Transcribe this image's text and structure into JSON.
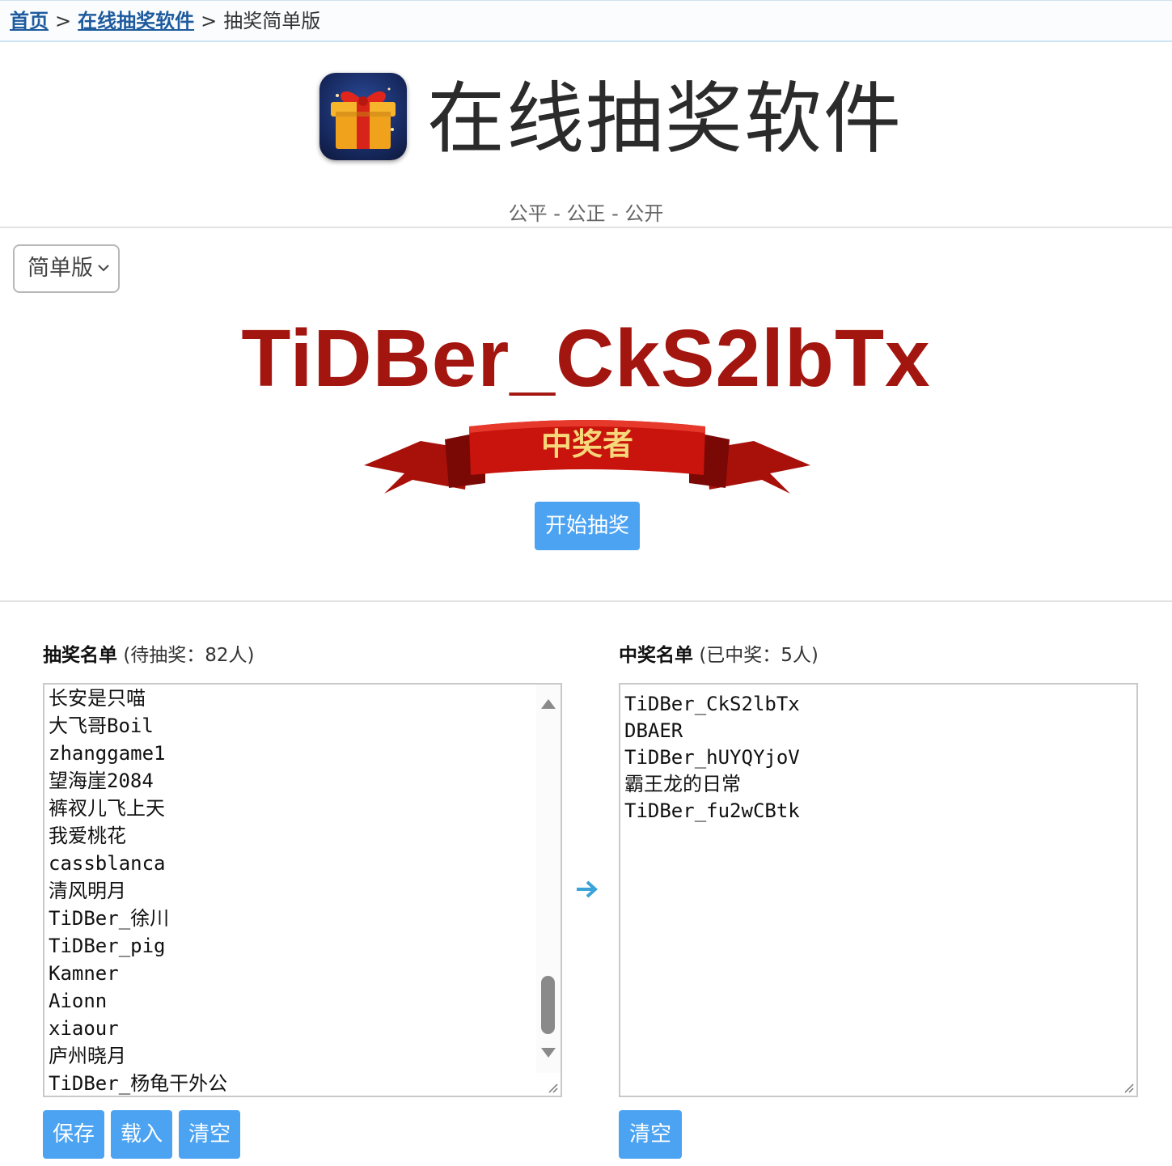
{
  "breadcrumb": {
    "home": "首页",
    "sep1": ">",
    "section": "在线抽奖软件",
    "sep2": ">",
    "current": "抽奖简单版"
  },
  "header": {
    "title": "在线抽奖软件",
    "subtitle": "公平 - 公正 - 公开"
  },
  "mode_select": {
    "value": "简单版"
  },
  "winner": {
    "name": "TiDBer_CkS2lbTx",
    "banner_text": "中奖者"
  },
  "start_button": "开始抽奖",
  "pool": {
    "title": "抽奖名单",
    "count_text": "(待抽奖：82人)",
    "entries": [
      "长安是只喵",
      "大飞哥Boil",
      "zhanggame1",
      "望海崖2084",
      "裤衩儿飞上天",
      "我爱桃花",
      "cassblanca",
      "清风明月",
      "TiDBer_徐川",
      "TiDBer_pig",
      "Kamner",
      "Aionn",
      "xiaour",
      "庐州晓月",
      "TiDBer_杨龟干外公"
    ],
    "buttons": {
      "save": "保存",
      "load": "载入",
      "clear": "清空"
    }
  },
  "winners": {
    "title": "中奖名单",
    "count_text": "(已中奖：5人)",
    "entries": [
      "TiDBer_CkS2lbTx",
      "DBAER",
      "TiDBer_hUYQYjoV",
      "霸王龙的日常",
      "TiDBer_fu2wCBtk"
    ],
    "buttons": {
      "clear": "清空"
    }
  },
  "colors": {
    "accent": "#4ba3f2",
    "winner_text": "#a3150f",
    "link": "#1e5b9e",
    "ribbon": "#c8140c",
    "ribbon_text": "#f6d77a"
  }
}
